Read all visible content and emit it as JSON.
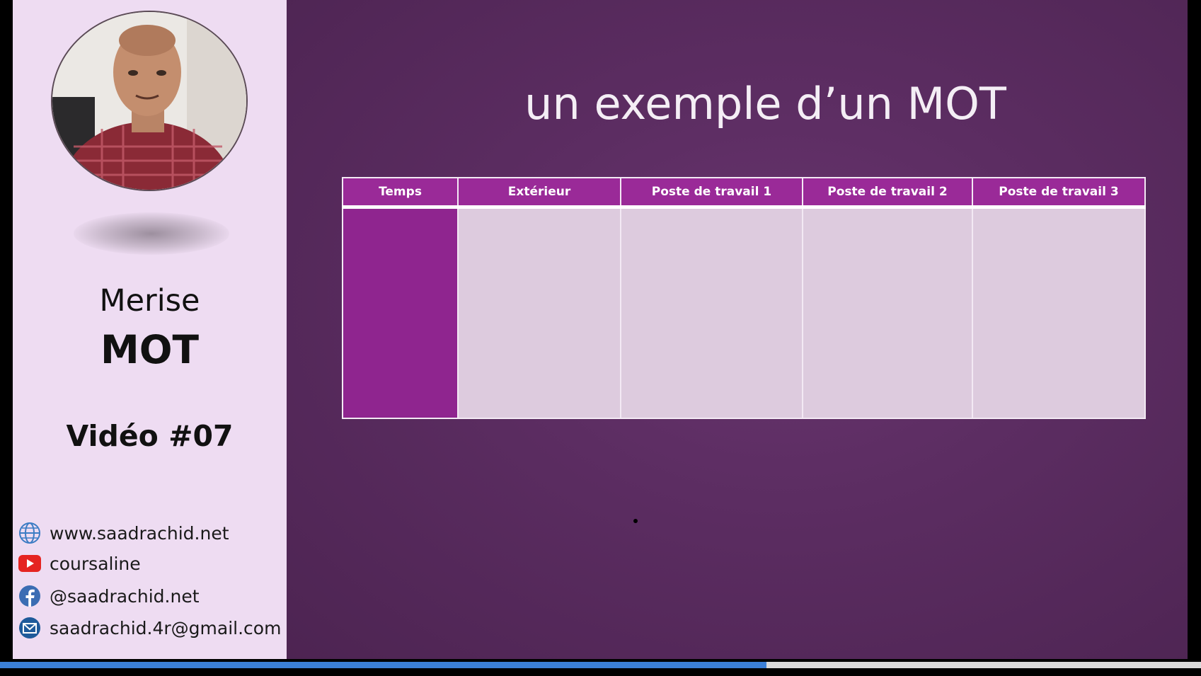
{
  "sidebar": {
    "course_name": "Merise",
    "course_topic": "MOT",
    "video_number": "Vidéo #07",
    "contacts": [
      {
        "icon": "globe-icon",
        "text": "www.saadrachid.net"
      },
      {
        "icon": "youtube-icon",
        "text": "coursaline"
      },
      {
        "icon": "facebook-icon",
        "text": "@saadrachid.net"
      },
      {
        "icon": "mail-icon",
        "text": "saadrachid.4r@gmail.com"
      }
    ]
  },
  "slide": {
    "title": "un exemple d’un MOT",
    "table": {
      "headers": [
        "Temps",
        "Extérieur",
        "Poste de travail 1",
        "Poste de travail 2",
        "Poste de travail 3"
      ]
    }
  },
  "player": {
    "progress_fraction": 0.638
  },
  "colors": {
    "sidebar_bg": "#eedcf2",
    "slide_bg": "#5c2d62",
    "table_header": "#9a2a98",
    "time_column": "#8f258f",
    "table_body": "#ddcbde",
    "progress": "#3b7fd6"
  }
}
